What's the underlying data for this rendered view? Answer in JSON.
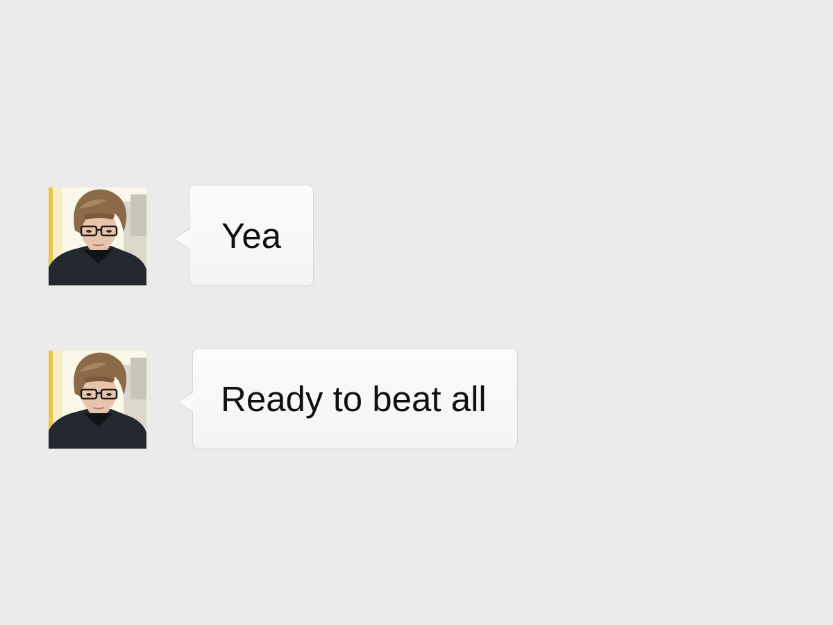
{
  "conversation": {
    "messages": [
      {
        "sender": "contact",
        "text": "Yea"
      },
      {
        "sender": "contact",
        "text": "Ready to beat all"
      }
    ]
  },
  "colors": {
    "background": "#ebebeb",
    "bubble": "#f8f8f8",
    "bubble_border": "#d6d6d6",
    "text": "#101010"
  }
}
